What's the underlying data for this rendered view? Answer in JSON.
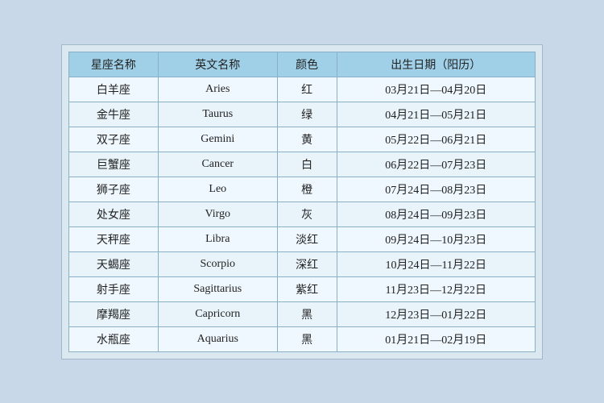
{
  "headers": {
    "col1": "星座名称",
    "col2": "英文名称",
    "col3": "颜色",
    "col4": "出生日期（阳历）"
  },
  "rows": [
    {
      "name": "白羊座",
      "en": "Aries",
      "color": "红",
      "date": "03月21日—04月20日"
    },
    {
      "name": "金牛座",
      "en": "Taurus",
      "color": "绿",
      "date": "04月21日—05月21日"
    },
    {
      "name": "双子座",
      "en": "Gemini",
      "color": "黄",
      "date": "05月22日—06月21日"
    },
    {
      "name": "巨蟹座",
      "en": "Cancer",
      "color": "白",
      "date": "06月22日—07月23日"
    },
    {
      "name": "狮子座",
      "en": "Leo",
      "color": "橙",
      "date": "07月24日—08月23日"
    },
    {
      "name": "处女座",
      "en": "Virgo",
      "color": "灰",
      "date": "08月24日—09月23日"
    },
    {
      "name": "天秤座",
      "en": "Libra",
      "color": "淡红",
      "date": "09月24日—10月23日"
    },
    {
      "name": "天蝎座",
      "en": "Scorpio",
      "color": "深红",
      "date": "10月24日—11月22日"
    },
    {
      "name": "射手座",
      "en": "Sagittarius",
      "color": "紫红",
      "date": "11月23日—12月22日"
    },
    {
      "name": "摩羯座",
      "en": "Capricorn",
      "color": "黑",
      "date": "12月23日—01月22日"
    },
    {
      "name": "水瓶座",
      "en": "Aquarius",
      "color": "黑",
      "date": "01月21日—02月19日"
    }
  ]
}
